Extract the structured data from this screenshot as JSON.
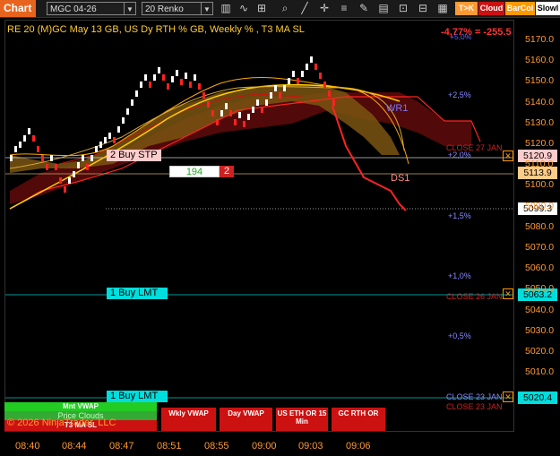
{
  "toolbar": {
    "chart_tab": "Chart",
    "instrument": "MGC 04-26",
    "bar_type": "20 Renko",
    "tk_label": "T>K",
    "cloud_label": "Cloud",
    "barcol_label": "BarCol",
    "slowl_label": "Slowl"
  },
  "chart": {
    "title": "RE 20  (M)GC May 13 GB, US Dy RTH % GB, Weekly % , T3 MA SL",
    "pct_top": "-4,77% = -255.5",
    "copyright": "© 2026 NinjaTrader, LLC",
    "wr1_label": "WR1",
    "ds1_label": "DS1",
    "y_axis": [
      "5170.0",
      "5160.0",
      "5150.0",
      "5140.0",
      "5130.0",
      "5120.0",
      "5110.0",
      "5100.0",
      "5090.0",
      "5080.0",
      "5070.0",
      "5060.0",
      "5050.0",
      "5040.0",
      "5030.0",
      "5020.0",
      "5010.0"
    ],
    "x_axis": [
      "08:40",
      "08:44",
      "08:47",
      "08:51",
      "08:55",
      "09:00",
      "09:03",
      "09:06"
    ],
    "pct_levels": [
      "+5,0%",
      "+2,5%",
      "+2,0%",
      "+1,5%",
      "+1,0%",
      "+0,5%"
    ],
    "close_labels": [
      "CLOSE 27 JAN",
      "CLOSE 26 JAN",
      "CLOSE 23 JAN",
      "CLOSE 23 JAN"
    ],
    "price_tags": {
      "stp": "5120.9",
      "pos": "5113.9",
      "last": "5099.3",
      "lmt1": "5063.2",
      "lmt2": "5020.4"
    },
    "orders": {
      "stp_label": "2 Buy STP",
      "lmt1_label": "1 Buy LMT",
      "lmt2_label": "1 Buy LMT",
      "pos_qty": "194",
      "pos_count": "2"
    },
    "buttons": {
      "mnt_vwap": "Mnt VWAP",
      "price_clouds": "Price Clouds",
      "t3_ma": "T3 MA SL",
      "wkly_vwap": "Wkly VWAP",
      "day_vwap": "Day VWAP",
      "us_eth": "US ETH OR 15 Min",
      "gc_rth": "GC RTH OR"
    },
    "colors": {
      "accent": "#e8641e",
      "up": "#ffffff",
      "down": "#ff2222",
      "order_line": "#00cccc"
    }
  }
}
